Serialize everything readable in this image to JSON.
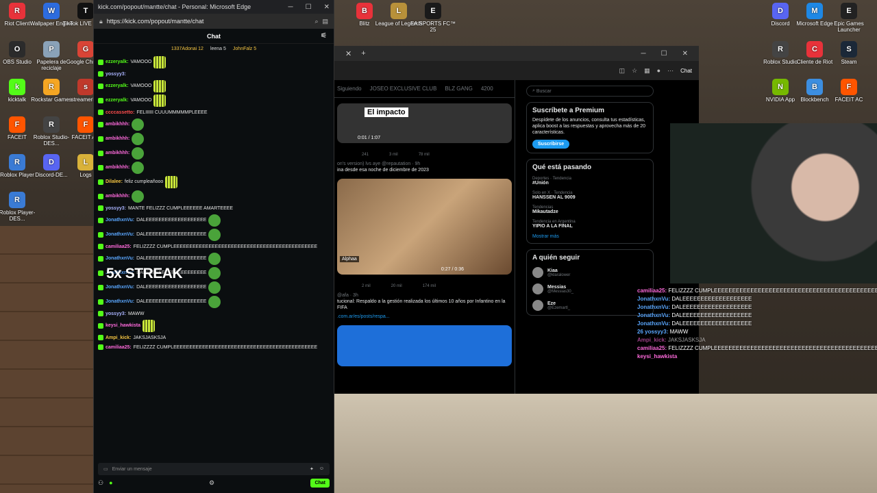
{
  "desktop_left": [
    {
      "label": "Riot Client",
      "color": "#e8323a",
      "icon": "riot-icon"
    },
    {
      "label": "Wallpaper Engine",
      "color": "#2d6cdf",
      "icon": "wallpaper-engine-icon"
    },
    {
      "label": "TikTok LIVE Studio",
      "color": "#111111",
      "icon": "tiktok-icon"
    },
    {
      "label": "OBS Studio",
      "color": "#2b2b2b",
      "icon": "obs-icon"
    },
    {
      "label": "Papelera de reciclaje",
      "color": "#8aa2b8",
      "icon": "recycle-bin-icon"
    },
    {
      "label": "Google Chrome",
      "color": "#d94436",
      "icon": "chrome-icon"
    },
    {
      "label": "kicktalk",
      "color": "#53fc18",
      "icon": "kicktalk-icon"
    },
    {
      "label": "Rockstar Games",
      "color": "#f5a623",
      "icon": "rockstar-icon"
    },
    {
      "label": "streamerbot",
      "color": "#c0392b",
      "icon": "streamerbot-icon"
    },
    {
      "label": "FACEIT",
      "color": "#ff5500",
      "icon": "faceit-icon"
    },
    {
      "label": "Roblox Studio-DES...",
      "color": "#444444",
      "icon": "roblox-studio-icon"
    },
    {
      "label": "FACEIT AC",
      "color": "#ff5500",
      "icon": "faceit-ac-icon"
    },
    {
      "label": "Roblox Player",
      "color": "#3a7bd5",
      "icon": "roblox-player-icon"
    },
    {
      "label": "Discord-DE...",
      "color": "#5865f2",
      "icon": "discord-icon"
    },
    {
      "label": "Logs",
      "color": "#d9b23a",
      "icon": "folder-icon"
    },
    {
      "label": "Roblox Player-DES...",
      "color": "#3a7bd5",
      "icon": "roblox-player-icon"
    }
  ],
  "desktop_top": [
    {
      "label": "Blitz",
      "color": "#e8323a",
      "icon": "blitz-icon"
    },
    {
      "label": "League of Legends",
      "color": "#b8913a",
      "icon": "league-icon"
    },
    {
      "label": "EA SPORTS FC™ 25",
      "color": "#1a1a1a",
      "icon": "ea-fc-icon"
    }
  ],
  "desktop_right": [
    {
      "label": "Discord",
      "color": "#5865f2",
      "icon": "discord-icon"
    },
    {
      "label": "Microsoft Edge",
      "color": "#1e88e5",
      "icon": "edge-icon"
    },
    {
      "label": "Epic Games Launcher",
      "color": "#222222",
      "icon": "epic-icon"
    },
    {
      "label": "Roblox Studio",
      "color": "#444444",
      "icon": "roblox-studio-icon"
    },
    {
      "label": "Cliente de Riot",
      "color": "#e8323a",
      "icon": "riot-icon"
    },
    {
      "label": "Steam",
      "color": "#1b2838",
      "icon": "steam-icon"
    },
    {
      "label": "NVIDIA App",
      "color": "#76b900",
      "icon": "nvidia-icon"
    },
    {
      "label": "Blockbench",
      "color": "#3c8ee0",
      "icon": "blockbench-icon"
    },
    {
      "label": "FACEIT AC",
      "color": "#ff5500",
      "icon": "faceit-icon"
    }
  ],
  "chat_window": {
    "title": "kick.com/popout/mantte/chat - Personal: Microsoft Edge",
    "url": "https://kick.com/popout/mantte/chat",
    "header": "Chat",
    "top_gifters": [
      "1337Adonai 12",
      "leena 5",
      "JohnFalz 5"
    ],
    "messages": [
      {
        "user": "ezzeryalk:",
        "text": "VAMOOO",
        "color": "#53fc18",
        "emote": "grid"
      },
      {
        "user": "yossyy3:",
        "text": "",
        "color": "#aab4ff",
        "emote": "none"
      },
      {
        "user": "ezzeryalk:",
        "text": "VAMOOO",
        "color": "#53fc18",
        "emote": "grid"
      },
      {
        "user": "ezzeryalk:",
        "text": "VAMOOO",
        "color": "#53fc18",
        "emote": "grid"
      },
      {
        "user": "ccccassetto:",
        "text": "FELIIIIII CUUUMMMMMPLEEEE",
        "color": "#ff4d4d",
        "emote": "none"
      },
      {
        "user": "ambikhhh:",
        "text": "",
        "color": "#ff6adc",
        "emote": "pepe"
      },
      {
        "user": "ambikhhh:",
        "text": "",
        "color": "#ff6adc",
        "emote": "pepe"
      },
      {
        "user": "ambikhhh:",
        "text": "",
        "color": "#ff6adc",
        "emote": "pepe"
      },
      {
        "user": "ambikhhh:",
        "text": "",
        "color": "#ff6adc",
        "emote": "pepe"
      },
      {
        "user": "Dilalee:",
        "text": "feliz cumpleañooo",
        "color": "#f5c542",
        "emote": "grid"
      },
      {
        "user": "ambikhhh:",
        "text": "",
        "color": "#ff6adc",
        "emote": "pepe"
      },
      {
        "user": "yossyy3:",
        "text": "MANTE FELIZZZ CUMPLEEEEEE AMARTEEEE",
        "color": "#aab4ff",
        "emote": "none"
      },
      {
        "user": "JonathxnVu:",
        "text": "DALEEEEEEEEEEEEEEEEEEE",
        "color": "#5aa7ff",
        "emote": "pepe"
      },
      {
        "user": "JonathxnVu:",
        "text": "DALEEEEEEEEEEEEEEEEEEE",
        "color": "#5aa7ff",
        "emote": "pepe"
      },
      {
        "user": "camiliaa25:",
        "text": "FELIZZZZ CUMPLEEEEEEEEEEEEEEEEEEEEEEEEEEEEEEEEEEEEEEEEEEEEE",
        "color": "#ff6adc",
        "emote": "none"
      },
      {
        "user": "JonathxnVu:",
        "text": "DALEEEEEEEEEEEEEEEEEEE",
        "color": "#5aa7ff",
        "emote": "pepe"
      },
      {
        "user": "JonathxnVu:",
        "text": "DALEEEEEEEEEEEEEEEEEEE",
        "color": "#5aa7ff",
        "emote": "pepe"
      },
      {
        "user": "JonathxnVu:",
        "text": "DALEEEEEEEEEEEEEEEEEEE",
        "color": "#5aa7ff",
        "emote": "pepe"
      },
      {
        "user": "JonathxnVu:",
        "text": "DALEEEEEEEEEEEEEEEEEEE",
        "color": "#5aa7ff",
        "emote": "pepe"
      },
      {
        "user": "yossyy3:",
        "text": "MAWW",
        "color": "#aab4ff",
        "emote": "none"
      },
      {
        "user": "keysi_hawkista",
        "text": "",
        "color": "#ff6adc",
        "emote": "grid"
      },
      {
        "user": "Ampi_kick:",
        "text": "JAKSJASKSJA",
        "color": "#f5c542",
        "emote": "none"
      },
      {
        "user": "camiliaa25:",
        "text": "FELIZZZZ CUMPLEEEEEEEEEEEEEEEEEEEEEEEEEEEEEEEEEEEEEEEEEEEEE",
        "color": "#ff6adc",
        "emote": "none"
      }
    ],
    "streak": "5x STREAK",
    "input_placeholder": "Enviar un mensaje",
    "chat_button": "Chat"
  },
  "browser": {
    "tabs_plus": "+",
    "copilot": "Chat",
    "x_tabs": [
      "Siguiendo",
      "JOSEO EXCLUSIVE CLUB",
      "BLZ GANG",
      "4200"
    ],
    "tweet1": {
      "overlay": "El impacto",
      "time": "0:01 / 1:07",
      "stats": [
        "241",
        "3 mil",
        "78 mil"
      ]
    },
    "tweet2": {
      "head": "on's version) lvs aye @repautation · 9h",
      "text": "ina desde esa noche de diciembre de 2023",
      "time": "0:27 / 0:36",
      "badge": "Alphaa",
      "stats": [
        "2 mil",
        "20 mil",
        "174 mil"
      ]
    },
    "tweet3": {
      "head": "@afa · 3h",
      "text": "tucional: Respaldo a la gestión realizada los últimos 10 años por Infantino en la FIFA",
      "link": ".com.ar/es/posts/respa..."
    },
    "search": "Buscar",
    "premium": {
      "title": "Suscríbete a Premium",
      "text": "Despídete de los anuncios, consulta tus estadísticas, aplica boost a las respuestas y aprovecha más de 20 características.",
      "button": "Suscribirse"
    },
    "trends_title": "Qué está pasando",
    "trends": [
      {
        "cat": "Deportes · Tendencia",
        "name": "#Unión"
      },
      {
        "cat": "Solo en X · Tendencia",
        "name": "HANSSEN AL 9009"
      },
      {
        "cat": "Tendencias",
        "name": "Mikautadze"
      },
      {
        "cat": "Tendencia en Argentina",
        "name": "YIPIO A LA FINAL"
      }
    ],
    "show_more": "Mostrar más",
    "follow_title": "A quién seguir",
    "follows": [
      {
        "name": "Kiaa",
        "handle": "@klaralower"
      },
      {
        "name": "Messias",
        "handle": "@Messias30_"
      },
      {
        "name": "Eze",
        "handle": "@Ezemartl_"
      }
    ],
    "follow_button": "Seguir"
  },
  "overlay_chat": [
    {
      "user": "camiliaa25:",
      "text": "FELIZZZZ CUMPLEEEEEEEEEEEEEEEEEEEEEEEEEEEEEEEEEEEEEEEEEEEEEEEEEEEEEEEEEEEEEEEEE",
      "cls": "ou"
    },
    {
      "user": "JonathxnVu:",
      "text": "DALEEEEEEEEEEEEEEEEEEE",
      "cls": "oj"
    },
    {
      "user": "JonathxnVu:",
      "text": "DALEEEEEEEEEEEEEEEEEEE",
      "cls": "oj"
    },
    {
      "user": "JonathxnVu:",
      "text": "DALEEEEEEEEEEEEEEEEEEE",
      "cls": "oj"
    },
    {
      "user": "JonathxnVu:",
      "text": "DALEEEEEEEEEEEEEEEEEEE",
      "cls": "oj"
    },
    {
      "user": "26 yossyy3:",
      "text": "MAWW",
      "cls": "oj"
    },
    {
      "user": "Ampi_kick:",
      "text": "JAKSJASKSJA",
      "cls": "ou"
    },
    {
      "user": "camiliaa25:",
      "text": "FELIZZZZ CUMPLEEEEEEEEEEEEEEEEEEEEEEEEEEEEEEEEEEEEEEEEEEEEEEEEEEEEEEEEEEEEEE",
      "cls": "ou"
    },
    {
      "user": "keysi_hawkista",
      "text": "",
      "cls": "ou"
    }
  ]
}
